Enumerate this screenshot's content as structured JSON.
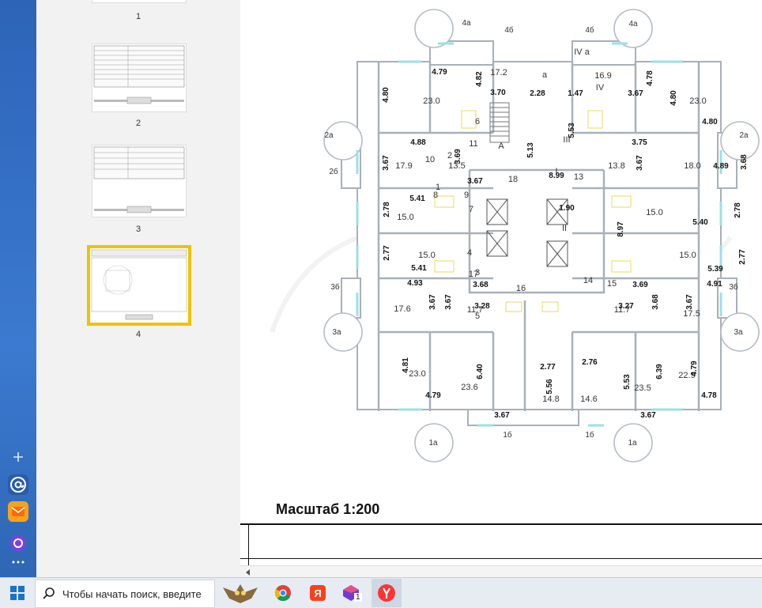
{
  "thumbnails": [
    {
      "label": "1",
      "selected": false
    },
    {
      "label": "2",
      "selected": false
    },
    {
      "label": "3",
      "selected": false
    },
    {
      "label": "4",
      "selected": true
    }
  ],
  "plan": {
    "stair_labels": [
      "IV a",
      "a",
      "A",
      "I",
      "II",
      "III",
      "IV"
    ],
    "room_numbers": [
      "1",
      "2",
      "3",
      "4",
      "5",
      "6",
      "7",
      "8",
      "9",
      "10",
      "11",
      "13",
      "14",
      "15",
      "16",
      "17",
      "18"
    ],
    "balcony_labels": [
      "4a",
      "4б",
      "4б",
      "4a",
      "2a",
      "2б",
      "2б",
      "2a",
      "3б",
      "3a",
      "3б",
      "3a",
      "1a",
      "1б",
      "1б",
      "1a"
    ],
    "area_labels": [
      "17.2",
      "23.0",
      "16.9",
      "23.0",
      "17.9",
      "13.5",
      "13.8",
      "18.0",
      "15.0",
      "15.0",
      "15.0",
      "15.0",
      "17.6",
      "11.7",
      "11.7",
      "17.5",
      "23.0",
      "23.6",
      "14.8",
      "14.6",
      "23.5",
      "22.9"
    ],
    "dimension_labels": [
      "4.79",
      "4.82",
      "4.80",
      "3.70",
      "2.28",
      "1.47",
      "5.53",
      "4.78",
      "3.67",
      "4.80",
      "4.80",
      "4.88",
      "3.67",
      "3.69",
      "3.67",
      "5.13",
      "8.99",
      "3.75",
      "3.67",
      "4.89",
      "3.68",
      "5.41",
      "2.78",
      "1.90",
      "8.97",
      "5.40",
      "2.78",
      "2.77",
      "5.41",
      "5.39",
      "2.77",
      "4.93",
      "3.68",
      "3.69",
      "4.91",
      "3.67",
      "3.67",
      "3.68",
      "3.67",
      "3.28",
      "3.27",
      "4.81",
      "6.40",
      "2.77",
      "2.76",
      "6.39",
      "4.79",
      "5.56",
      "5.53",
      "4.79",
      "4.78",
      "3.67",
      "3.67"
    ]
  },
  "scale_label": "Масштаб 1:200",
  "taskbar": {
    "search_placeholder": "Чтобы начать поиск, введите",
    "badge_count": "1"
  },
  "colors": {
    "selection": "#f2c100",
    "wall": "#a8b0b8",
    "window_line": "#9be0e6",
    "furniture": "#e9e37a"
  },
  "icons": [
    "plus-icon",
    "mail-at-icon",
    "envelope-icon",
    "alice-icon",
    "more-icon",
    "windows-icon",
    "search-icon",
    "owl-widget-icon",
    "chrome-icon",
    "yandex-icon",
    "office-icon",
    "yandex-browser-icon"
  ]
}
